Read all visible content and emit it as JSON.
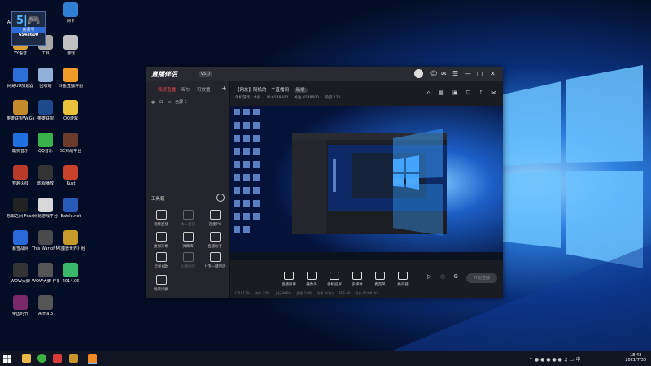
{
  "desktop": {
    "icons": [
      {
        "label": "Adm..."
      },
      {
        "label": "网卡"
      },
      {
        "label": "YY语音"
      },
      {
        "label": "工具"
      },
      {
        "label": "游戏"
      },
      {
        "label": "网易UU加速器"
      },
      {
        "label": "回收站"
      },
      {
        "label": "斗鱼直播伴侣"
      },
      {
        "label": "英雄联盟WeGame版"
      },
      {
        "label": "英雄联盟"
      },
      {
        "label": "QQ游戏"
      },
      {
        "label": "酷狗音乐"
      },
      {
        "label": "QQ音乐"
      },
      {
        "label": "5E对战平台"
      },
      {
        "label": "穿越火线"
      },
      {
        "label": "影视播放"
      },
      {
        "label": "Rust"
      },
      {
        "label": "恐惧之间 Fear sur..."
      },
      {
        "label": "网易游戏平台"
      },
      {
        "label": "Battle.net"
      },
      {
        "label": "暴雪战网"
      },
      {
        "label": "This War of Mine"
      },
      {
        "label": "《魔兽世界》经典怀旧服"
      },
      {
        "label": "WOW大脚"
      },
      {
        "label": "WOW大脚-怀旧服"
      },
      {
        "label": "2014.06"
      },
      {
        "label": "帝国时代"
      },
      {
        "label": "Arma 3"
      }
    ],
    "watermark_id": "6548600",
    "watermark_label": "房间号"
  },
  "window": {
    "brand": "直播伴侣",
    "version": "v5.0",
    "controls": {
      "minimize": "—",
      "maximize": "□",
      "close": "✕"
    },
    "left_tabs": [
      "视频直播",
      "画布",
      "可放置"
    ],
    "scene_label": "全屏 1",
    "tools_title": "工具箱",
    "tools": [
      {
        "label": "视频直播",
        "dim": false
      },
      {
        "label": "本人直播",
        "dim": true
      },
      {
        "label": "连麦PK",
        "dim": false
      },
      {
        "label": "虚拟形象",
        "dim": false
      },
      {
        "label": "弹幕库",
        "dim": false
      },
      {
        "label": "直播助手",
        "dim": false
      },
      {
        "label": "全民K歌",
        "dim": false
      },
      {
        "label": "人物动作",
        "dim": true
      },
      {
        "label": "上传一键回放",
        "dim": false
      },
      {
        "label": "场景切换",
        "dim": false
      }
    ],
    "room": {
      "title": "【网友】随机的一个直播间",
      "badge": "新版",
      "meta": [
        "单机游戏 · 大屏",
        "ID:6548600",
        "关注 6548600",
        "热度 120"
      ]
    },
    "bottom_buttons": [
      "直播屏幕",
      "摄像头",
      "手机投屏",
      "多媒体",
      "麦克风",
      "扬声器"
    ],
    "start_label": "开始直播",
    "status": [
      "CPU 13%",
      "内存 23%",
      "上行 0KB/s",
      "丢帧 0.0%",
      "码率 0kbps",
      "FPS 60",
      "时长 00:00:00"
    ]
  },
  "taskbar": {
    "time": "18:43",
    "date": "2021/7/30"
  }
}
